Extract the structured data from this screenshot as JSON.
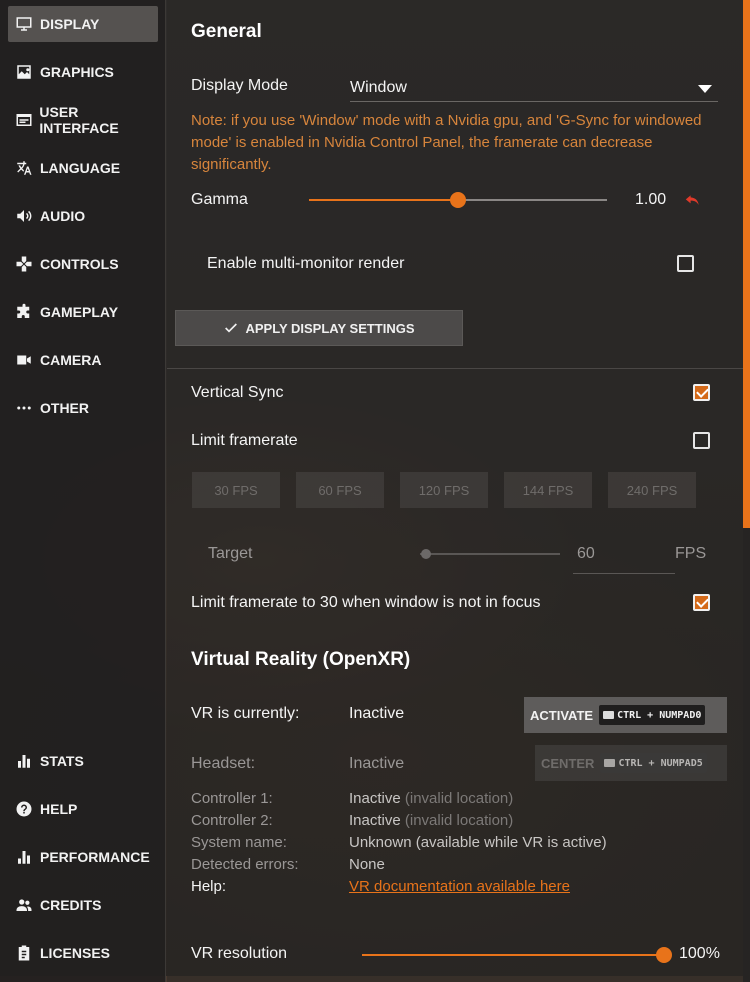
{
  "sidebar": {
    "top_items": [
      {
        "label": "DISPLAY",
        "icon": "monitor-icon",
        "active": true
      },
      {
        "label": "GRAPHICS",
        "icon": "image-icon"
      },
      {
        "label": "USER INTERFACE",
        "icon": "ui-window-icon"
      },
      {
        "label": "LANGUAGE",
        "icon": "translate-icon"
      },
      {
        "label": "AUDIO",
        "icon": "speaker-icon"
      },
      {
        "label": "CONTROLS",
        "icon": "gamepad-icon"
      },
      {
        "label": "GAMEPLAY",
        "icon": "puzzle-icon"
      },
      {
        "label": "CAMERA",
        "icon": "camera-icon"
      },
      {
        "label": "OTHER",
        "icon": "more-dots-icon"
      }
    ],
    "bottom_items": [
      {
        "label": "STATS",
        "icon": "bar-chart-icon"
      },
      {
        "label": "HELP",
        "icon": "help-icon"
      },
      {
        "label": "PERFORMANCE",
        "icon": "performance-icon"
      },
      {
        "label": "CREDITS",
        "icon": "people-icon"
      },
      {
        "label": "LICENSES",
        "icon": "clipboard-icon"
      }
    ]
  },
  "general": {
    "title": "General",
    "display_mode_label": "Display Mode",
    "display_mode_value": "Window",
    "note": "Note: if you use 'Window' mode with a Nvidia gpu, and 'G-Sync for windowed mode' is enabled in Nvidia Control Panel, the framerate can decrease significantly.",
    "gamma_label": "Gamma",
    "gamma_value": "1.00",
    "gamma_fraction": 0.5,
    "multi_monitor_label": "Enable multi-monitor render",
    "multi_monitor_checked": false,
    "apply_label": "APPLY DISPLAY SETTINGS"
  },
  "framerate": {
    "vsync_label": "Vertical Sync",
    "vsync_checked": true,
    "limit_label": "Limit framerate",
    "limit_checked": false,
    "presets": [
      "30 FPS",
      "60 FPS",
      "120 FPS",
      "144 FPS",
      "240 FPS"
    ],
    "target_label": "Target",
    "target_value": "60",
    "target_unit": "FPS",
    "focus_label": "Limit framerate to 30 when window is not in focus",
    "focus_checked": true
  },
  "vr": {
    "title": "Virtual Reality (OpenXR)",
    "status_label": "VR is currently:",
    "status_value": "Inactive",
    "activate_label": "ACTIVATE",
    "activate_shortcut": "CTRL + NUMPAD0",
    "headset_label": "Headset:",
    "headset_value": "Inactive",
    "center_label": "CENTER",
    "center_shortcut": "CTRL + NUMPAD5",
    "rows": [
      {
        "label": "Controller 1:",
        "value": "Inactive",
        "extra": "(invalid location)"
      },
      {
        "label": "Controller 2:",
        "value": "Inactive",
        "extra": "(invalid location)"
      },
      {
        "label": "System name:",
        "value": "Unknown (available while VR is active)",
        "extra": ""
      },
      {
        "label": "Detected errors:",
        "value": "None",
        "extra": ""
      }
    ],
    "help_label": "Help:",
    "help_link": "VR documentation available here",
    "resolution_label": "VR resolution",
    "resolution_value": "100%",
    "resolution_fraction": 1.0
  },
  "colors": {
    "accent": "#e8731a",
    "note": "#d7853c",
    "reset_icon": "#e03a2a"
  }
}
